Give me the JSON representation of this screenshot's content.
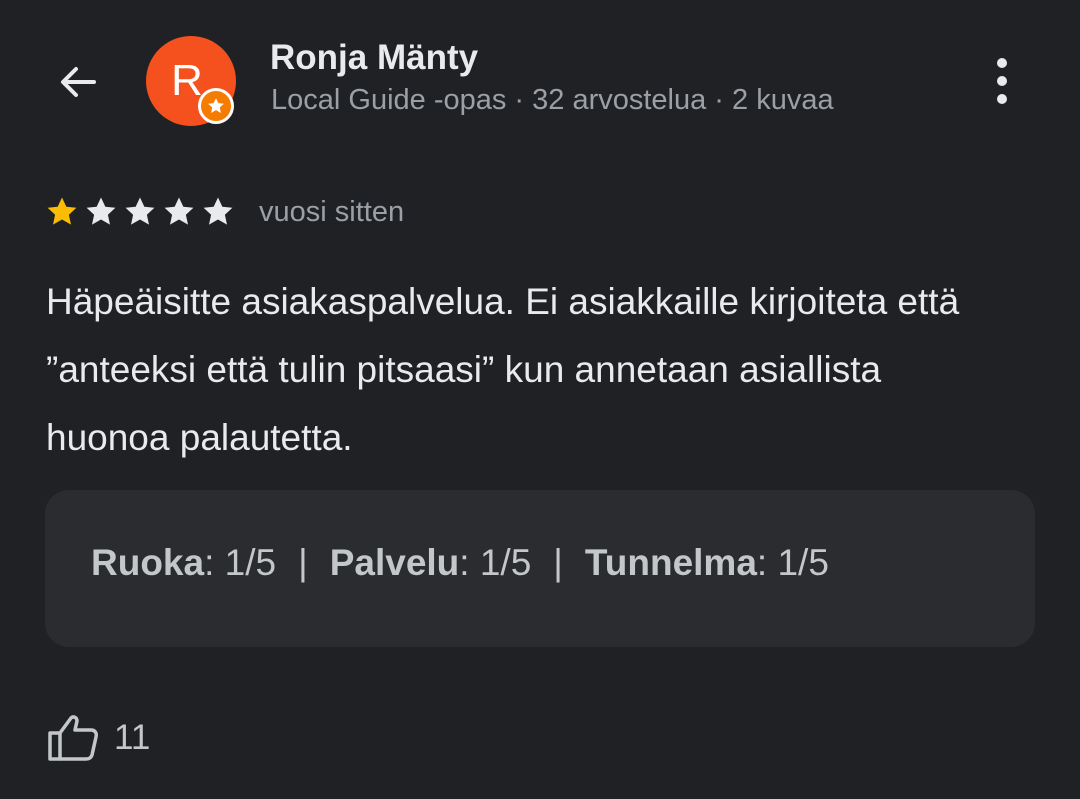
{
  "colors": {
    "background": "#202124",
    "avatar": "#f4511e",
    "guide_badge": "#f57c00",
    "star_filled": "#fbbc04",
    "star_empty": "#e8eaed",
    "text_primary": "#e8eaed",
    "text_secondary": "#9aa0a6",
    "card_background": "#2b2c30"
  },
  "header": {
    "back_icon": "arrow-left-icon",
    "more_icon": "more-vertical-icon"
  },
  "reviewer": {
    "initial": "R",
    "name": "Ronja Mänty",
    "meta": "Local Guide -opas · 32 arvostelua · 2 kuvaa",
    "badge_icon": "star-icon"
  },
  "review": {
    "rating": 1,
    "max_rating": 5,
    "date": "vuosi sitten",
    "text": "Häpeäisitte asiakaspalvelua. Ei asiakkaille kirjoiteta että ”anteeksi että tulin pitsaasi” kun annetaan asiallista huonoa palautetta."
  },
  "sub_ratings": [
    {
      "label": "Ruoka",
      "value": ": 1/5"
    },
    {
      "label": "Palvelu",
      "value": ": 1/5"
    },
    {
      "label": "Tunnelma",
      "value": ": 1/5"
    }
  ],
  "sub_ratings_separator": "|",
  "likes": {
    "icon": "thumbs-up-icon",
    "count": "11"
  }
}
